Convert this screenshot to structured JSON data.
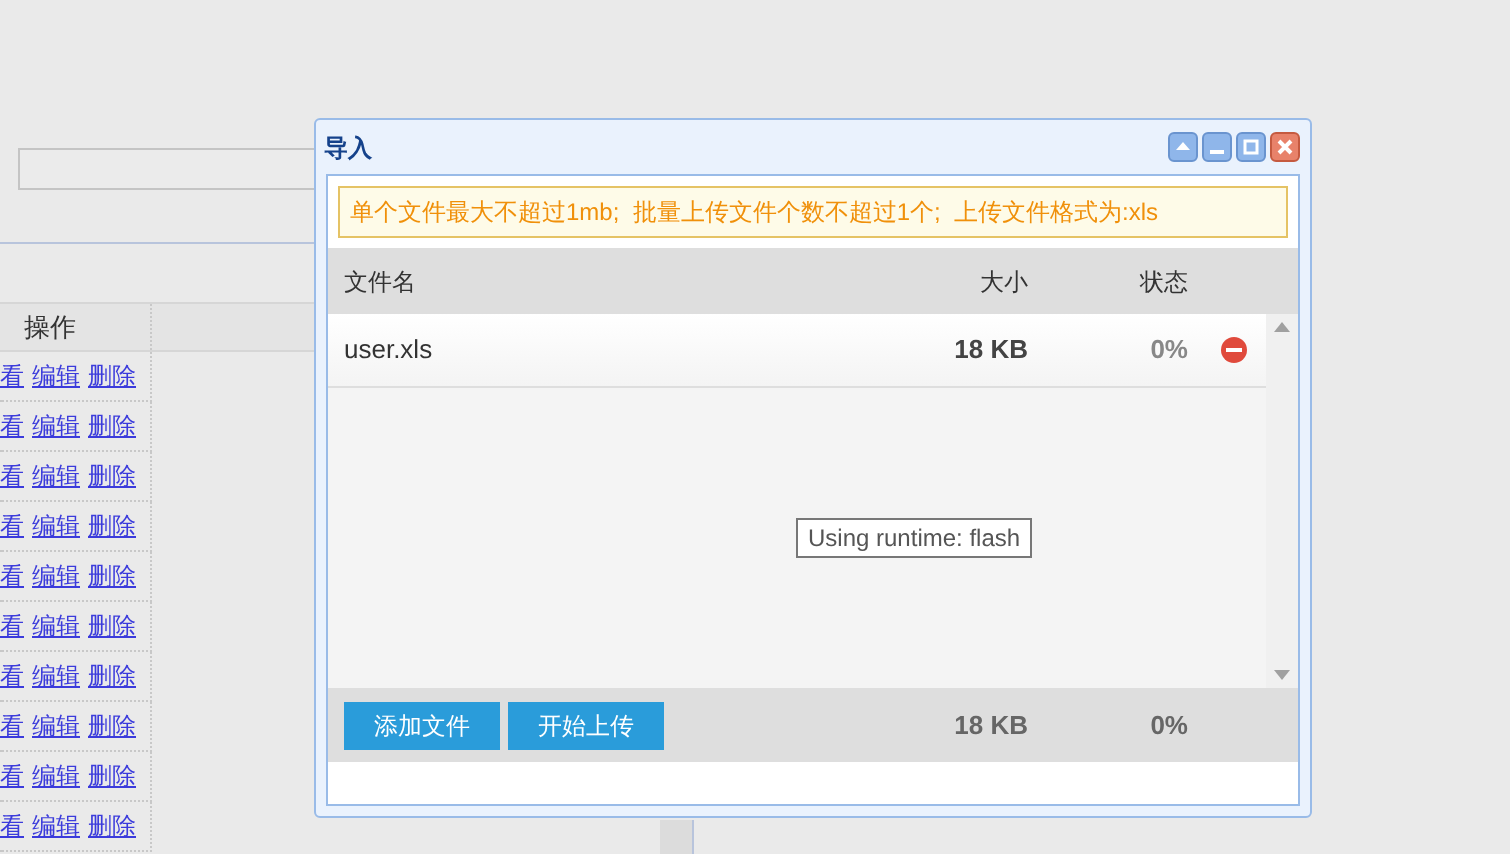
{
  "page": {
    "operations": {
      "header": "操作",
      "rows": [
        {
          "links": [
            "看",
            "编辑",
            "删除"
          ]
        },
        {
          "links": [
            "看",
            "编辑",
            "删除"
          ]
        },
        {
          "links": [
            "看",
            "编辑",
            "删除"
          ]
        },
        {
          "links": [
            "看",
            "编辑",
            "删除"
          ]
        },
        {
          "links": [
            "看",
            "编辑",
            "删除"
          ]
        },
        {
          "links": [
            "看",
            "编辑",
            "删除"
          ]
        },
        {
          "links": [
            "看",
            "编辑",
            "删除"
          ]
        },
        {
          "links": [
            "看",
            "编辑",
            "删除"
          ]
        },
        {
          "links": [
            "看",
            "编辑",
            "删除"
          ]
        },
        {
          "links": [
            "看",
            "编辑",
            "删除"
          ]
        }
      ]
    }
  },
  "dialog": {
    "title": "导入",
    "notice": "单个文件最大不超过1mb;  批量上传文件个数不超过1个;  上传文件格式为:xls",
    "columns": [
      "文件名",
      "大小",
      "状态"
    ],
    "files": [
      {
        "name": "user.xls",
        "size": "18 KB",
        "status": "0%"
      }
    ],
    "tooltip": "Using runtime: flash",
    "buttons": [
      "添加文件",
      "开始上传"
    ],
    "total_size": "18 KB",
    "total_status": "0%"
  }
}
